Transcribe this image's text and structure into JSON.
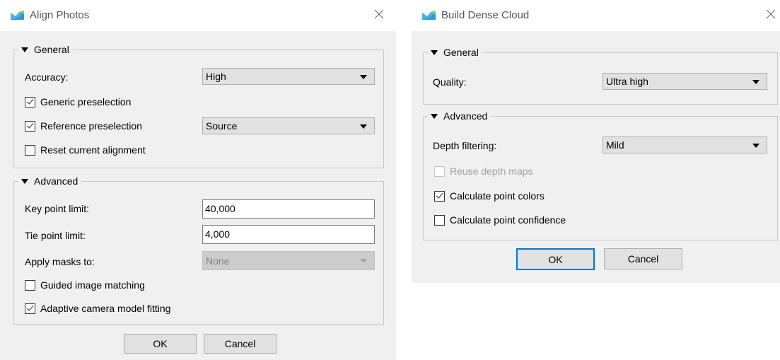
{
  "align_photos": {
    "title": "Align Photos",
    "general": {
      "legend": "General",
      "accuracy_label": "Accuracy:",
      "accuracy_value": "High",
      "generic_preselection": {
        "label": "Generic preselection",
        "checked": true
      },
      "reference_preselection": {
        "label": "Reference preselection",
        "checked": true
      },
      "reference_value": "Source",
      "reset_alignment": {
        "label": "Reset current alignment",
        "checked": false
      }
    },
    "advanced": {
      "legend": "Advanced",
      "key_point_label": "Key point limit:",
      "key_point_value": "40,000",
      "tie_point_label": "Tie point limit:",
      "tie_point_value": "4,000",
      "apply_masks_label": "Apply masks to:",
      "apply_masks_value": "None",
      "guided_matching": {
        "label": "Guided image matching",
        "checked": false
      },
      "adaptive_fitting": {
        "label": "Adaptive camera model fitting",
        "checked": true
      }
    },
    "ok_label": "OK",
    "cancel_label": "Cancel"
  },
  "build_dense_cloud": {
    "title": "Build Dense Cloud",
    "general": {
      "legend": "General",
      "quality_label": "Quality:",
      "quality_value": "Ultra high"
    },
    "advanced": {
      "legend": "Advanced",
      "depth_filtering_label": "Depth filtering:",
      "depth_filtering_value": "Mild",
      "reuse_depth_maps": {
        "label": "Reuse depth maps",
        "checked": false,
        "disabled": true
      },
      "calc_point_colors": {
        "label": "Calculate point colors",
        "checked": true
      },
      "calc_point_confidence": {
        "label": "Calculate point confidence",
        "checked": false
      }
    },
    "ok_label": "OK",
    "cancel_label": "Cancel"
  },
  "icons": {
    "app": "metashape-app-icon",
    "close": "close-icon",
    "collapse": "collapse-triangle-icon",
    "dropdown": "dropdown-arrow-icon"
  },
  "colors": {
    "accent": "#0078d7",
    "dialog_bg": "#f0f0f0",
    "titlebar_bg": "#ffffff",
    "disabled_text": "#a0a0a0"
  }
}
